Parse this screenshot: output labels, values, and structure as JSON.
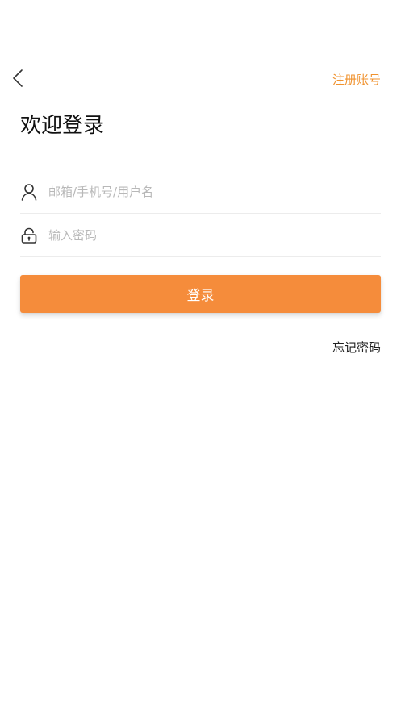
{
  "colors": {
    "accent": "#F58C3B",
    "register_text": "#F0922E",
    "divider": "#ECECEC",
    "placeholder": "#B8B8B8"
  },
  "header": {
    "back_icon": "chevron-left-icon",
    "register_label": "注册账号"
  },
  "title": "欢迎登录",
  "form": {
    "username": {
      "icon": "user-icon",
      "value": "",
      "placeholder": "邮箱/手机号/用户名"
    },
    "password": {
      "icon": "lock-icon",
      "value": "",
      "placeholder": "输入密码"
    },
    "login_label": "登录",
    "forgot_label": "忘记密码"
  }
}
